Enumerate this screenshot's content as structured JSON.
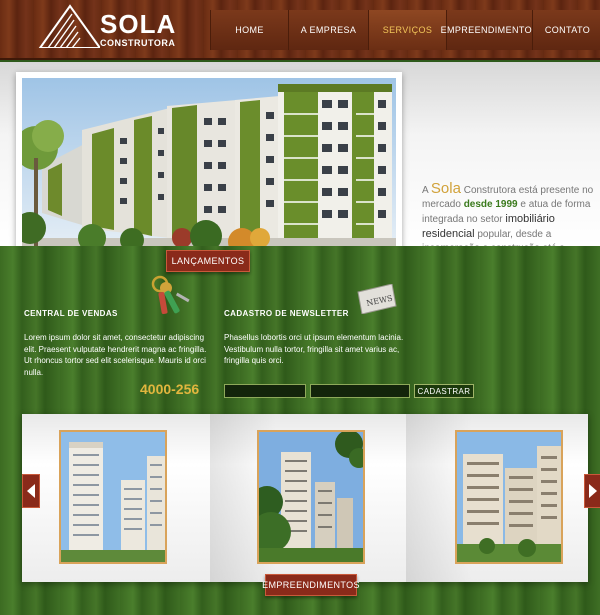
{
  "logo": {
    "name": "SOLA",
    "subtitle": "CONSTRUTORA"
  },
  "nav": {
    "items": [
      {
        "label": "HOME"
      },
      {
        "label": "A EMPRESA"
      },
      {
        "label": "SERVIÇOS",
        "active": true
      },
      {
        "label": "EMPREENDIMENTOS"
      },
      {
        "label": "CONTATO"
      }
    ]
  },
  "banner": {
    "intro_a": "A ",
    "brand": "Sola",
    "intro_b": " Construtora está presente no mercado ",
    "since": "desde 1999",
    "intro_c": " e atua de forma integrada no setor ",
    "segment": "imobiliário residencial",
    "intro_d": " popular, desde a incorporação e construção até a comercialização dos imóveis."
  },
  "launch_label": "LANÇAMENTOS",
  "sales": {
    "title": "CENTRAL DE VENDAS",
    "text": "Lorem ipsum dolor sit amet, consectetur adipiscing elit. Praesent vulputate hendrerit magna ac fringilla. Ut rhoncus tortor sed elit scelerisque. Mauris id orci nulla.",
    "phone": "4000-256"
  },
  "newsletter": {
    "title": "CADASTRO DE NEWSLETTER",
    "text": "Phasellus lobortis orci ut ipsum elementum lacinia. Vestibulum nulla tortor, fringilla sit amet varius ac, fringilla quis orci.",
    "name_value": "",
    "email_value": "",
    "button": "CADASTRAR",
    "badge": "NEWS"
  },
  "projects_label": "EMPREENDIMENTOS",
  "colors": {
    "wood_brown": "#6a2c13",
    "accent_gold": "#d1a23a",
    "tag_red": "#8a2a1a",
    "green": "#3c6b22"
  }
}
